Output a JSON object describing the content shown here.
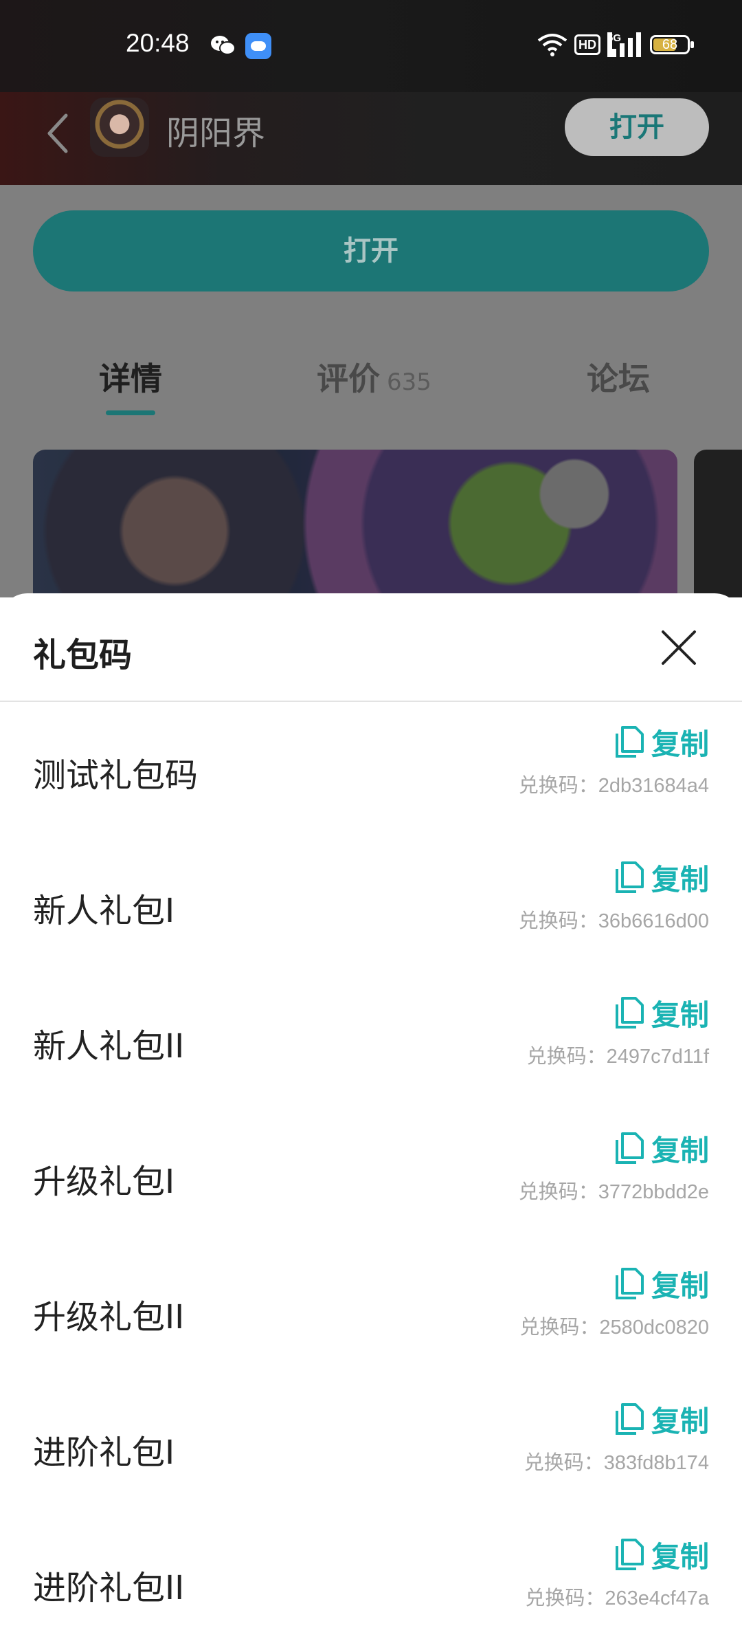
{
  "status_bar": {
    "time": "20:48",
    "battery": "68",
    "network": "5G",
    "hd": "HD"
  },
  "app_bar": {
    "app_name": "阴阳界",
    "open_label": "打开"
  },
  "page": {
    "open_button": "打开",
    "tabs": [
      {
        "label": "详情"
      },
      {
        "label": "评价",
        "count": "635"
      },
      {
        "label": "论坛"
      }
    ]
  },
  "sheet": {
    "title": "礼包码",
    "items": [
      {
        "name": "测试礼包码",
        "copy_label": "复制",
        "code": "兑换码：2db31684a4"
      },
      {
        "name": "新人礼包I",
        "copy_label": "复制",
        "code": "兑换码：36b6616d00"
      },
      {
        "name": "新人礼包II",
        "copy_label": "复制",
        "code": "兑换码：2497c7d11f"
      },
      {
        "name": "升级礼包I",
        "copy_label": "复制",
        "code": "兑换码：3772bbdd2e"
      },
      {
        "name": "升级礼包II",
        "copy_label": "复制",
        "code": "兑换码：2580dc0820"
      },
      {
        "name": "进阶礼包I",
        "copy_label": "复制",
        "code": "兑换码：383fd8b174"
      },
      {
        "name": "进阶礼包II",
        "copy_label": "复制",
        "code": "兑换码：263e4cf47a"
      }
    ]
  },
  "colors": {
    "accent": "#1ab3b3",
    "primary_dark": "#1c7675"
  },
  "icons": [
    "back-icon",
    "wechat-icon",
    "app-badge-icon",
    "wifi-icon",
    "signal-icon",
    "battery-icon",
    "close-icon",
    "copy-icon"
  ]
}
